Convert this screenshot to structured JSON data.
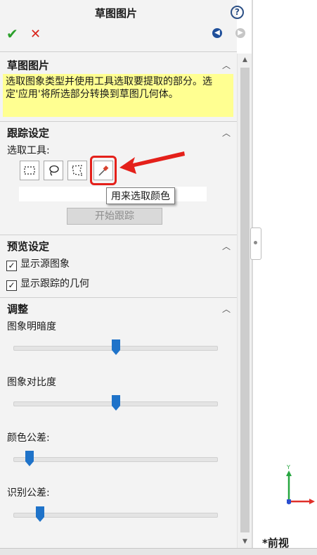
{
  "header": {
    "title": "草图图片",
    "help_icon": "?"
  },
  "sections": {
    "sketch_picture": {
      "title": "草图图片",
      "message": "选取图象类型并使用工具选取要提取的部分。选定'应用'将所选部分转换到草图几何体。"
    },
    "trace": {
      "title": "跟踪设定",
      "select_tools_label": "选取工具:",
      "tools": [
        "rectangle-select-icon",
        "lasso-select-icon",
        "polygon-select-icon",
        "color-picker-icon"
      ],
      "tooltip": "用来选取颜色",
      "start_button": "开始跟踪"
    },
    "preview": {
      "title": "预览设定",
      "show_source": {
        "label": "显示源图象",
        "checked": true
      },
      "show_traced": {
        "label": "显示跟踪的几何",
        "checked": true
      }
    },
    "adjust": {
      "title": "调整",
      "sliders": [
        {
          "label": "图象明暗度",
          "value": 0.5
        },
        {
          "label": "图象对比度",
          "value": 0.5
        },
        {
          "label": "颜色公差:",
          "value": 0.08
        },
        {
          "label": "识别公差:",
          "value": 0.13
        }
      ]
    }
  },
  "viewport": {
    "view_label": "*前视",
    "triad_axis_label": "Y"
  },
  "colors": {
    "accent": "#1f73c9",
    "highlight": "#e4201a",
    "message_bg": "#ffff91"
  }
}
